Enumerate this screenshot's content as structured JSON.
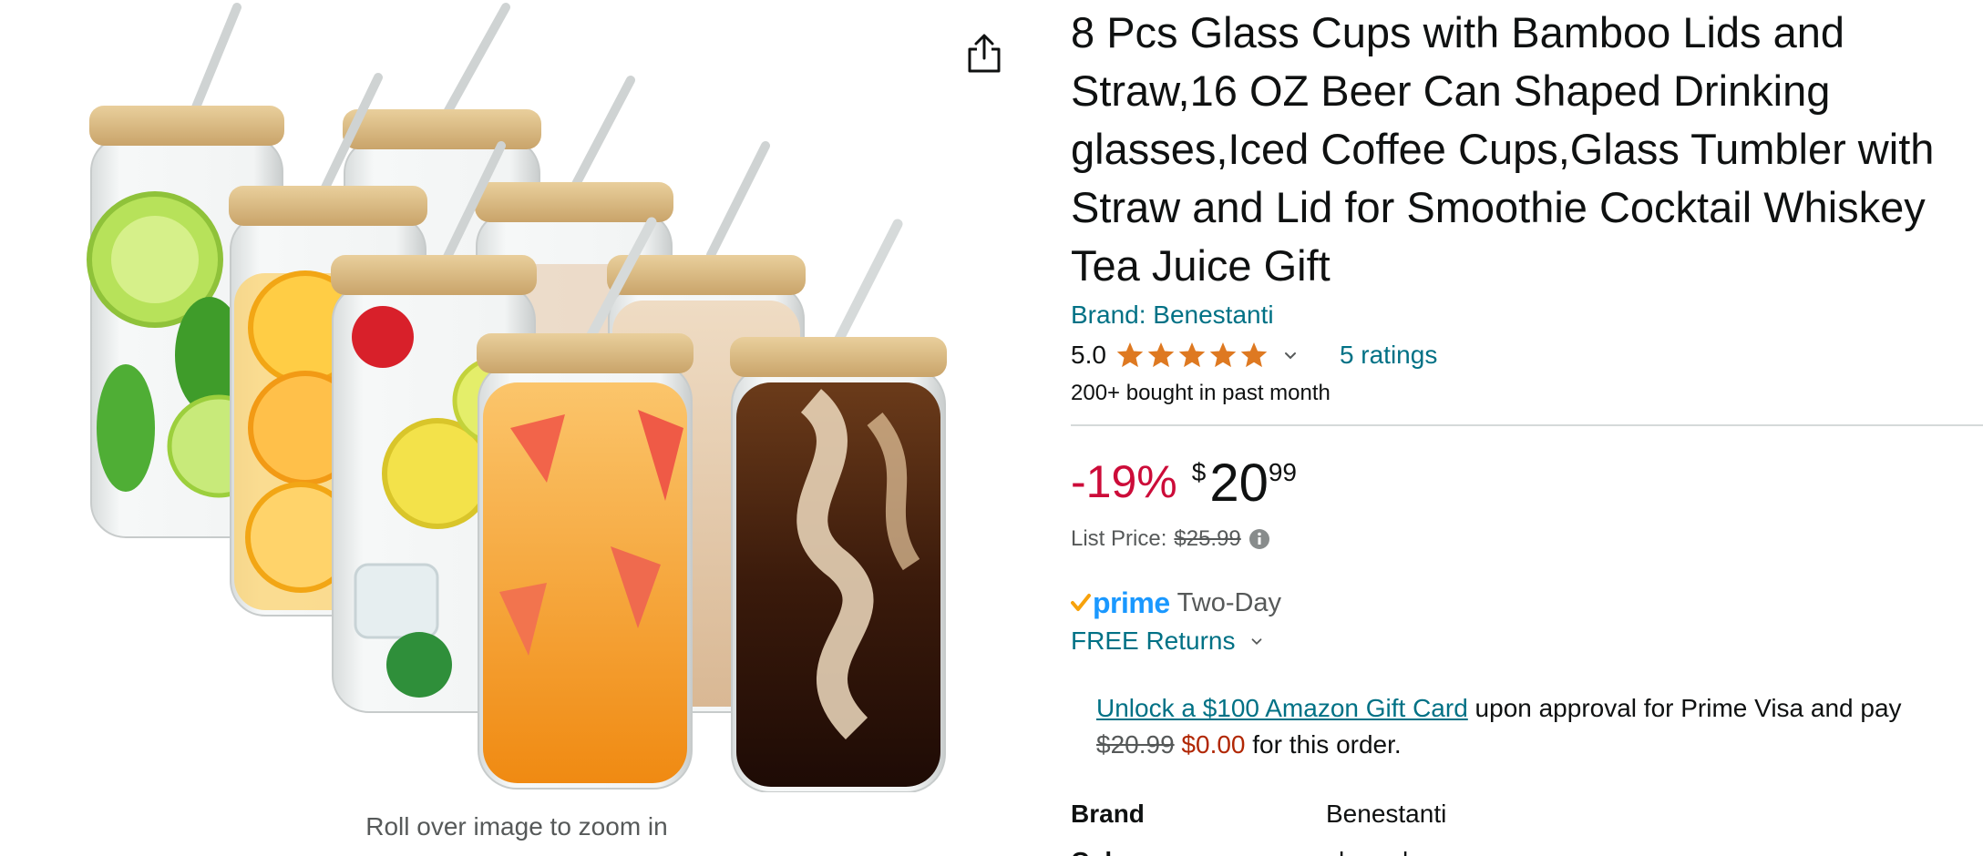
{
  "gallery": {
    "zoom_hint": "Roll over image to zoom in"
  },
  "product": {
    "title": "8 Pcs Glass Cups with Bamboo Lids and Straw,16 OZ Beer Can Shaped Drinking glasses,Iced Coffee Cups,Glass Tumbler with Straw and Lid for Smoothie Cocktail Whiskey Tea Juice Gift",
    "brand_link": "Brand: Benestanti",
    "rating_value": "5.0",
    "stars_filled": 5,
    "ratings_count": "5 ratings",
    "bought_text": "200+ bought in past month"
  },
  "pricing": {
    "discount": "-19%",
    "currency_symbol": "$",
    "price_whole": "20",
    "price_fraction": "99",
    "list_price_label": "List Price:",
    "list_price_value": "$25.99"
  },
  "delivery": {
    "prime_word": "prime",
    "prime_speed": "Two-Day",
    "returns_label": "FREE Returns"
  },
  "offer": {
    "link_text": "Unlock a $100 Amazon Gift Card",
    "middle_text": " upon approval for Prime Visa and pay ",
    "old_price": "$20.99",
    "new_price": "$0.00",
    "end_text": " for this order."
  },
  "specs": [
    {
      "label": "Brand",
      "value": "Benestanti"
    },
    {
      "label": "Color",
      "value": "clear glass"
    }
  ],
  "colors": {
    "link": "#007185",
    "discount": "#cc0c39",
    "star": "#de7921",
    "prime": "#1a98ff",
    "offer_price": "#b12704"
  },
  "icons": {
    "share": "share-icon",
    "star": "star-icon",
    "chevron": "chevron-down-icon",
    "info": "info-icon",
    "prime_check": "prime-check-icon"
  }
}
